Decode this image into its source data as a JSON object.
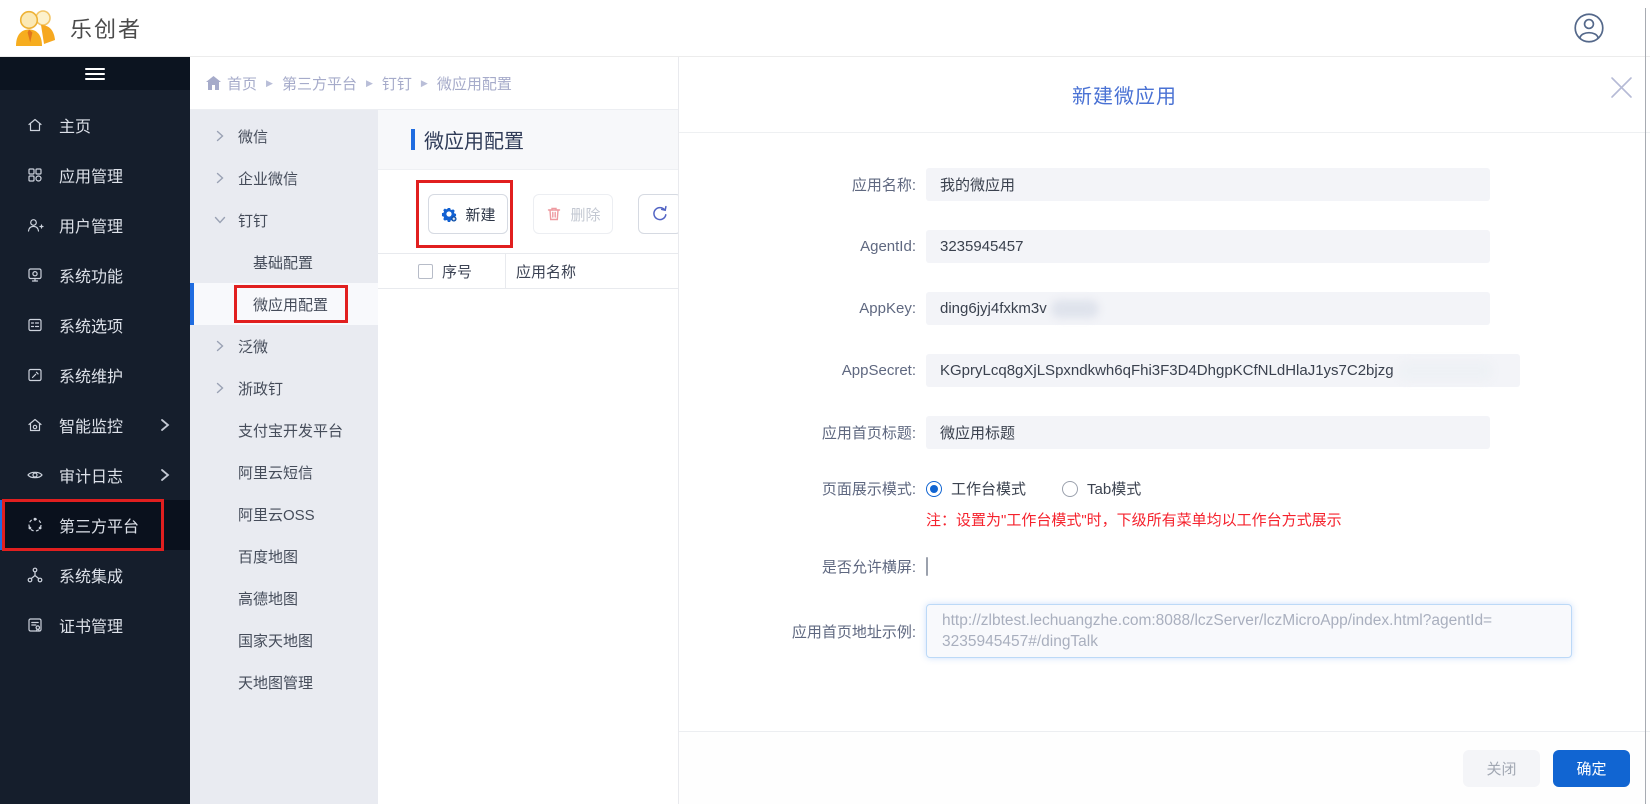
{
  "topbar": {
    "brand": "乐创者"
  },
  "sidebar": {
    "items": [
      {
        "label": "主页"
      },
      {
        "label": "应用管理"
      },
      {
        "label": "用户管理"
      },
      {
        "label": "系统功能"
      },
      {
        "label": "系统选项"
      },
      {
        "label": "系统维护"
      },
      {
        "label": "智能监控",
        "expandable": true
      },
      {
        "label": "审计日志",
        "expandable": true
      },
      {
        "label": "第三方平台",
        "active": true,
        "annotated": true
      },
      {
        "label": "系统集成"
      },
      {
        "label": "证书管理"
      }
    ]
  },
  "submenu": {
    "items": [
      {
        "label": "微信",
        "chevron": "right"
      },
      {
        "label": "企业微信",
        "chevron": "right"
      },
      {
        "label": "钉钉",
        "chevron": "down",
        "expanded": true
      },
      {
        "label": "基础配置",
        "child": true
      },
      {
        "label": "微应用配置",
        "child": true,
        "active": true,
        "annotated": true
      },
      {
        "label": "泛微",
        "chevron": "right"
      },
      {
        "label": "浙政钉",
        "chevron": "right"
      },
      {
        "label": "支付宝开发平台"
      },
      {
        "label": "阿里云短信"
      },
      {
        "label": "阿里云OSS"
      },
      {
        "label": "百度地图"
      },
      {
        "label": "高德地图"
      },
      {
        "label": "国家天地图"
      },
      {
        "label": "天地图管理"
      }
    ]
  },
  "breadcrumb": {
    "home": "首页",
    "items": [
      "第三方平台",
      "钉钉",
      "微应用配置"
    ],
    "separator": "▶"
  },
  "list_panel": {
    "title": "微应用配置",
    "toolbar": {
      "create": "新建",
      "delete": "删除"
    },
    "table": {
      "col_seq": "序号",
      "col_name": "应用名称"
    }
  },
  "modal": {
    "title": "新建微应用",
    "rows": {
      "app_name": {
        "label": "应用名称:",
        "value": "我的微应用"
      },
      "agent_id": {
        "label": "AgentId:",
        "value": "3235945457"
      },
      "app_key": {
        "label": "AppKey:",
        "value": "ding6jyj4fxkm3v",
        "masked": true
      },
      "app_secret": {
        "label": "AppSecret:",
        "value": "KGpryLcq8gXjLSpxndkwh6qFhi3F3D4DhgpKCfNLdHlaJ1ys7C2bjzg",
        "masked": true
      },
      "home_title": {
        "label": "应用首页标题:",
        "value": "微应用标题"
      },
      "display_mode": {
        "label": "页面展示模式:",
        "option_workbench": "工作台模式",
        "option_tab": "Tab模式",
        "selected": "工作台模式",
        "note": "注：设置为\"工作台模式\"时，下级所有菜单均以工作台方式展示"
      },
      "landscape": {
        "label": "是否允许横屏:",
        "checked": false
      },
      "home_url": {
        "label": "应用首页地址示例:",
        "line1": "http://zlbtest.lechuangzhe.com:8088/lczServer/lczMicroApp/index.html?agentId=",
        "line2": "3235945457#/dingTalk",
        "full": "http://zlbtest.lechuangzhe.com:8088/lczServer/lczMicroApp/index.html?agentId=3235945457#/dingTalk"
      }
    },
    "footer": {
      "close": "关闭",
      "ok": "确定"
    }
  },
  "colors": {
    "accent_blue": "#1165d2",
    "title_blue": "#4a72d4",
    "annotation_red": "#e11f1f",
    "note_red": "#f5222d",
    "sidebar_bg": "#151e2c",
    "sidebar_active_bg": "#0a111d",
    "submenu_bg": "#e9ebf1"
  }
}
